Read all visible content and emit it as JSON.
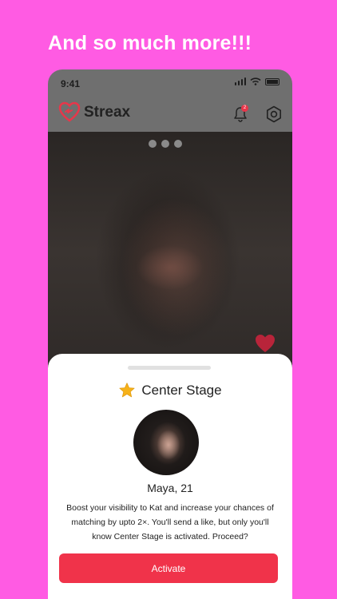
{
  "headline": "And so much more!!!",
  "status_bar": {
    "time": "9:41"
  },
  "app": {
    "name": "Streax",
    "notification_count": "2"
  },
  "photo": {
    "carousel_dots": 3
  },
  "sheet": {
    "title": "Center Stage",
    "profile": {
      "name_age": "Maya, 21"
    },
    "description": "Boost your visibility to Kat and increase your chances of matching by upto 2×. You'll send a like, but only you'll know Center Stage is activated. Proceed?",
    "button_label": "Activate"
  },
  "colors": {
    "background": "#FF5BE3",
    "accent": "#F0334A",
    "star": "#F6B21A"
  },
  "icons": [
    "heart-logo-icon",
    "bell-icon",
    "gear-icon",
    "heart-icon",
    "star-icon",
    "signal-icon",
    "wifi-icon",
    "battery-icon"
  ]
}
